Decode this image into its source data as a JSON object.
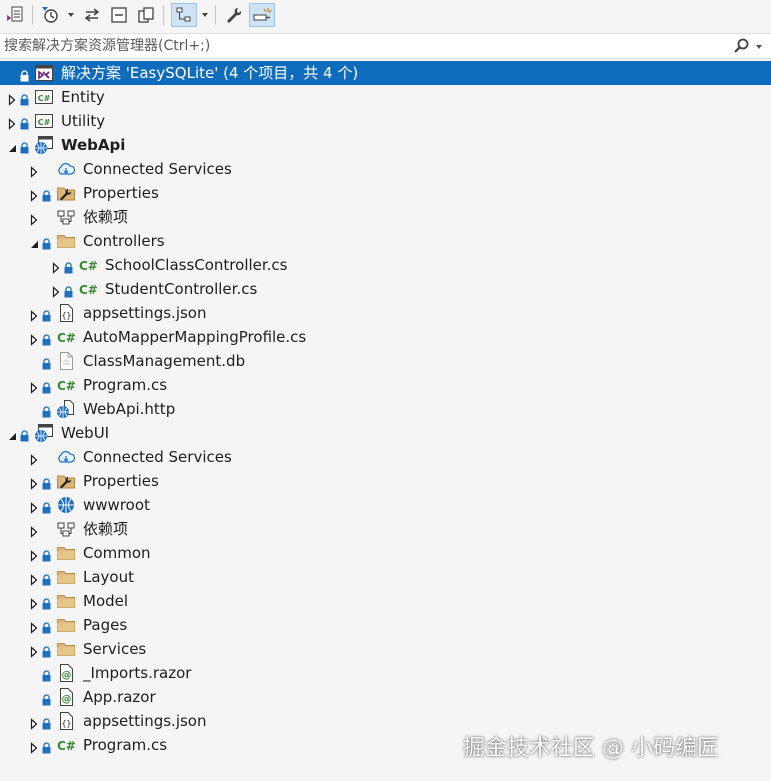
{
  "search": {
    "placeholder": "搜索解决方案资源管理器(Ctrl+;)"
  },
  "toolbar": {
    "icons": [
      "switch-views-icon",
      "pending-changes-filter-icon",
      "sync-active-document-icon",
      "collapse-all-icon",
      "show-all-files-icon",
      "preview-selected-items-icon",
      "properties-wrench-icon",
      "toggle-preview-icon"
    ]
  },
  "tree": [
    {
      "label": "解决方案 'EasySQLite' (4 个项目，共 4 个)",
      "depth": 0,
      "expander": "none",
      "lock": true,
      "icon": "solution",
      "bold": false,
      "selected": true
    },
    {
      "label": "Entity",
      "depth": 0,
      "expander": "collapsed",
      "lock": true,
      "icon": "csproj",
      "bold": false
    },
    {
      "label": "Utility",
      "depth": 0,
      "expander": "collapsed",
      "lock": true,
      "icon": "csproj",
      "bold": false
    },
    {
      "label": "WebApi",
      "depth": 0,
      "expander": "expanded",
      "lock": true,
      "icon": "webproj",
      "bold": true
    },
    {
      "label": "Connected Services",
      "depth": 1,
      "expander": "collapsed",
      "lock": false,
      "icon": "cloud",
      "bold": false
    },
    {
      "label": "Properties",
      "depth": 1,
      "expander": "collapsed",
      "lock": true,
      "icon": "properties",
      "bold": false
    },
    {
      "label": "依赖项",
      "depth": 1,
      "expander": "collapsed",
      "lock": false,
      "icon": "deps",
      "bold": false
    },
    {
      "label": "Controllers",
      "depth": 1,
      "expander": "expanded",
      "lock": true,
      "icon": "folder",
      "bold": false
    },
    {
      "label": "SchoolClassController.cs",
      "depth": 2,
      "expander": "collapsed",
      "lock": true,
      "icon": "csharp",
      "bold": false
    },
    {
      "label": "StudentController.cs",
      "depth": 2,
      "expander": "collapsed",
      "lock": true,
      "icon": "csharp",
      "bold": false
    },
    {
      "label": "appsettings.json",
      "depth": 1,
      "expander": "collapsed",
      "lock": true,
      "icon": "json",
      "bold": false
    },
    {
      "label": "AutoMapperMappingProfile.cs",
      "depth": 1,
      "expander": "collapsed",
      "lock": true,
      "icon": "csharp",
      "bold": false
    },
    {
      "label": "ClassManagement.db",
      "depth": 1,
      "expander": "none",
      "lock": true,
      "icon": "file",
      "bold": false
    },
    {
      "label": "Program.cs",
      "depth": 1,
      "expander": "collapsed",
      "lock": true,
      "icon": "csharp",
      "bold": false
    },
    {
      "label": "WebApi.http",
      "depth": 1,
      "expander": "none",
      "lock": true,
      "icon": "http",
      "bold": false
    },
    {
      "label": "WebUI",
      "depth": 0,
      "expander": "expanded",
      "lock": true,
      "icon": "webproj",
      "bold": false
    },
    {
      "label": "Connected Services",
      "depth": 1,
      "expander": "collapsed",
      "lock": false,
      "icon": "cloud",
      "bold": false
    },
    {
      "label": "Properties",
      "depth": 1,
      "expander": "collapsed",
      "lock": true,
      "icon": "properties",
      "bold": false
    },
    {
      "label": "wwwroot",
      "depth": 1,
      "expander": "collapsed",
      "lock": true,
      "icon": "globe",
      "bold": false
    },
    {
      "label": "依赖项",
      "depth": 1,
      "expander": "collapsed",
      "lock": false,
      "icon": "deps",
      "bold": false
    },
    {
      "label": "Common",
      "depth": 1,
      "expander": "collapsed",
      "lock": true,
      "icon": "folder",
      "bold": false
    },
    {
      "label": "Layout",
      "depth": 1,
      "expander": "collapsed",
      "lock": true,
      "icon": "folder",
      "bold": false
    },
    {
      "label": "Model",
      "depth": 1,
      "expander": "collapsed",
      "lock": true,
      "icon": "folder",
      "bold": false
    },
    {
      "label": "Pages",
      "depth": 1,
      "expander": "collapsed",
      "lock": true,
      "icon": "folder",
      "bold": false
    },
    {
      "label": "Services",
      "depth": 1,
      "expander": "collapsed",
      "lock": true,
      "icon": "folder",
      "bold": false
    },
    {
      "label": "_Imports.razor",
      "depth": 1,
      "expander": "none",
      "lock": true,
      "icon": "razor",
      "bold": false
    },
    {
      "label": "App.razor",
      "depth": 1,
      "expander": "none",
      "lock": true,
      "icon": "razor",
      "bold": false
    },
    {
      "label": "appsettings.json",
      "depth": 1,
      "expander": "collapsed",
      "lock": true,
      "icon": "json",
      "bold": false
    },
    {
      "label": "Program.cs",
      "depth": 1,
      "expander": "collapsed",
      "lock": true,
      "icon": "csharp",
      "bold": false
    }
  ],
  "watermark": "掘金技术社区 @ 小码编匠",
  "colors": {
    "selection": "#0f6cbd",
    "folder": "#dcb67a",
    "csharp": "#388a34",
    "lock": "#1f6fbf"
  }
}
